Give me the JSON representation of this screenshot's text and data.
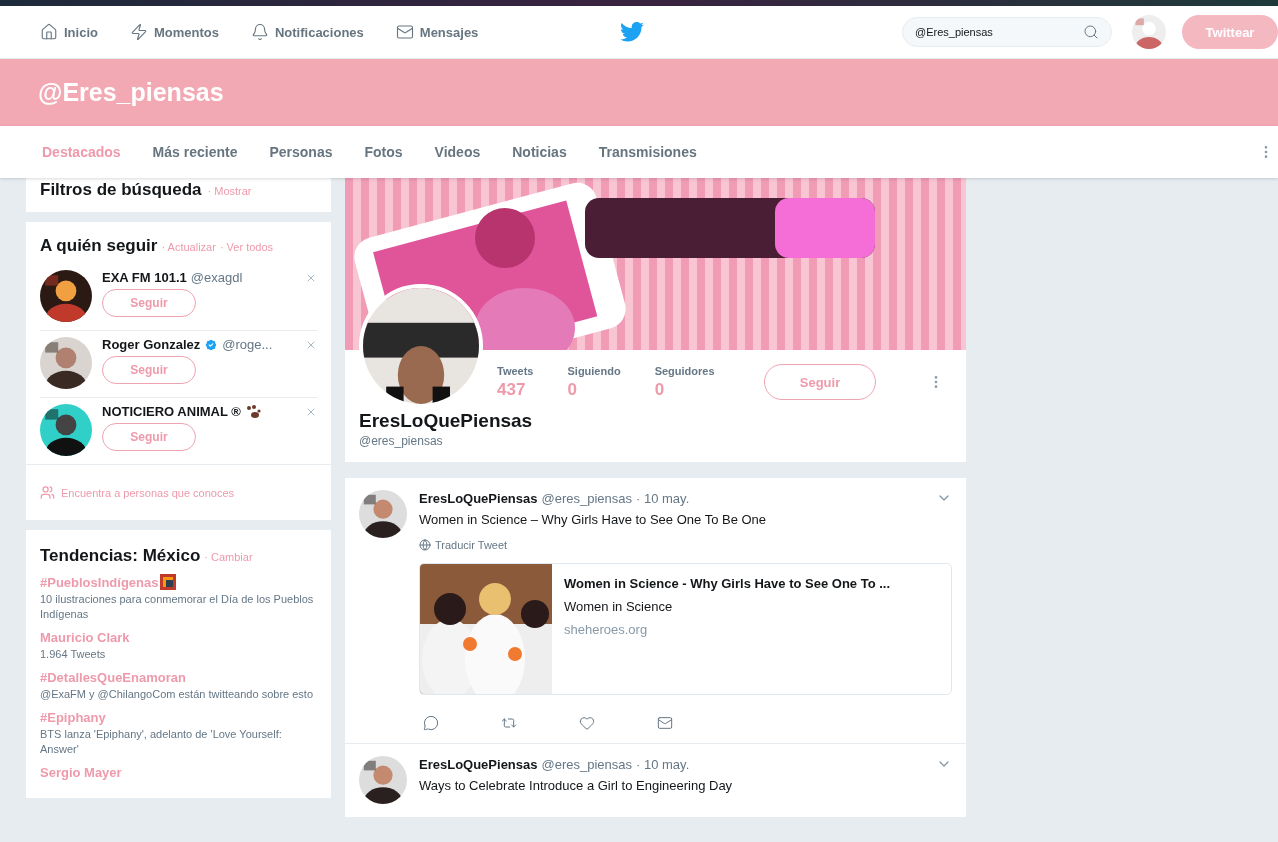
{
  "nav": {
    "items": [
      {
        "label": "Inicio"
      },
      {
        "label": "Momentos"
      },
      {
        "label": "Notificaciones"
      },
      {
        "label": "Mensajes"
      }
    ],
    "search": {
      "value": "@Eres_piensas"
    },
    "tweet_button": "Twittear"
  },
  "header": {
    "title": "@Eres_piensas"
  },
  "tabs": [
    {
      "label": "Destacados",
      "selected": true
    },
    {
      "label": "Más reciente",
      "selected": false
    },
    {
      "label": "Personas",
      "selected": false
    },
    {
      "label": "Fotos",
      "selected": false
    },
    {
      "label": "Videos",
      "selected": false
    },
    {
      "label": "Noticias",
      "selected": false
    },
    {
      "label": "Transmisiones",
      "selected": false
    }
  ],
  "filters": {
    "title": "Filtros de búsqueda",
    "link": "· Mostrar"
  },
  "who_to_follow": {
    "title": "A quién seguir",
    "links": [
      "· Actualizar",
      "· Ver todos"
    ],
    "accounts": [
      {
        "name": "EXA FM 101.1",
        "handle": "@exagdl",
        "kind": "plain",
        "button": "Seguir"
      },
      {
        "name": "Roger Gonzalez",
        "handle": "@roge...",
        "kind": "verified",
        "button": "Seguir"
      },
      {
        "name": "NOTICIERO ANIMAL ®",
        "kind": "paw",
        "button": "Seguir"
      }
    ],
    "find_people": "Encuentra a personas que conoces"
  },
  "trends": {
    "title": "Tendencias: México",
    "link": "· Cambiar",
    "items": [
      {
        "name": "#PueblosIndígenas",
        "kind": "hashflag",
        "description": "10 ilustraciones para conmemorar el Día de los Pueblos Indígenas"
      },
      {
        "name": "Mauricio Clark",
        "kind": "plain",
        "description": "1.964 Tweets"
      },
      {
        "name": "#DetallesQueEnamoran",
        "kind": "plain",
        "description": "@ExaFM y @ChilangoCom están twitteando sobre esto"
      },
      {
        "name": "#Epiphany",
        "kind": "plain",
        "description": "BTS lanza 'Epiphany', adelanto de 'Love Yourself: Answer'"
      },
      {
        "name": "Sergio Mayer",
        "kind": "plain"
      }
    ]
  },
  "profile": {
    "stats": [
      {
        "label": "Tweets",
        "value": "437"
      },
      {
        "label": "Siguiendo",
        "value": "0"
      },
      {
        "label": "Seguidores",
        "value": "0"
      }
    ],
    "button": "Seguir",
    "name": "EresLoQuePiensas",
    "handle": "@eres_piensas"
  },
  "tweets": [
    {
      "author": "EresLoQuePiensas",
      "handle": "@eres_piensas",
      "date": "· 10 may.",
      "text": "Women in Science – Why Girls Have to See One To Be One",
      "translate": "Traducir Tweet",
      "card": {
        "title": "Women in Science - Why Girls Have to See One To ...",
        "subtitle": "Women in Science",
        "domain": "sheheroes.org"
      }
    },
    {
      "author": "EresLoQuePiensas",
      "handle": "@eres_piensas",
      "date": "· 10 may.",
      "text": "Ways to Celebrate Introduce a Girl to Engineering Day"
    }
  ]
}
